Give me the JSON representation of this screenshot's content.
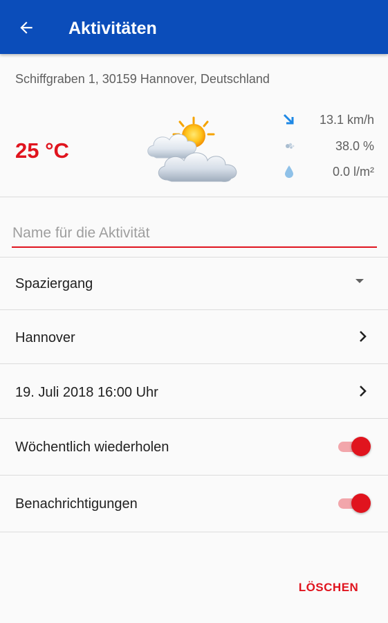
{
  "appbar": {
    "title": "Aktivitäten",
    "back_icon": "arrow-left-icon",
    "color": "#0b4dba"
  },
  "weather": {
    "address": "Schiffgraben 1, 30159 Hannover, Deutschland",
    "temperature": "25 °C",
    "condition_icon": "partly-cloudy-icon",
    "wind": {
      "icon": "wind-direction-icon",
      "value": "13.1 km/h"
    },
    "humidity": {
      "icon": "humidity-icon",
      "value": "38.0 %"
    },
    "precipitation": {
      "icon": "raindrop-icon",
      "value": "0.0 l/m²"
    }
  },
  "form": {
    "name_placeholder": "Name für die Aktivität",
    "name_value": "",
    "activity_type": {
      "selected": "Spaziergang",
      "icon": "dropdown-arrow-icon"
    },
    "location": {
      "label": "Hannover",
      "icon": "chevron-right-icon"
    },
    "datetime": {
      "label": "19. Juli 2018 16:00 Uhr",
      "icon": "chevron-right-icon"
    },
    "repeat_weekly": {
      "label": "Wöchentlich wiederholen",
      "on": true
    },
    "notifications": {
      "label": "Benachrichtigungen",
      "on": true
    }
  },
  "actions": {
    "delete_label": "LÖSCHEN"
  },
  "colors": {
    "accent": "#e0141e",
    "toggle_track": "#f2a6ab"
  }
}
